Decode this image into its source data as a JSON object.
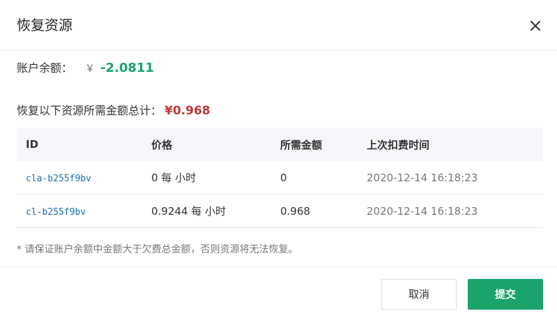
{
  "dialog": {
    "title": "恢复资源",
    "close_icon": "close-icon"
  },
  "balance": {
    "label": "账户余额：",
    "currency": "￥",
    "amount": "-2.0811",
    "amount_color": "#1aa36a"
  },
  "total": {
    "label": "恢复以下资源所需金额总计：",
    "amount": "¥0.968",
    "amount_color": "#c03639"
  },
  "table": {
    "headers": [
      "ID",
      "价格",
      "所需金额",
      "上次扣费时间"
    ],
    "rows": [
      {
        "id": "cla-b255f9bv",
        "price": "0 每 小时",
        "amount": "0",
        "time": "2020-12-14 16:18:23"
      },
      {
        "id": "cl-b255f9bv",
        "price": "0.9244 每 小时",
        "amount": "0.968",
        "time": "2020-12-14 16:18:23"
      }
    ]
  },
  "notice": "* 请保证账户余额中金额大于欠费总金额，否则资源将无法恢复。",
  "footer": {
    "cancel_label": "取消",
    "submit_label": "提交",
    "submit_color": "#1aa36a"
  }
}
